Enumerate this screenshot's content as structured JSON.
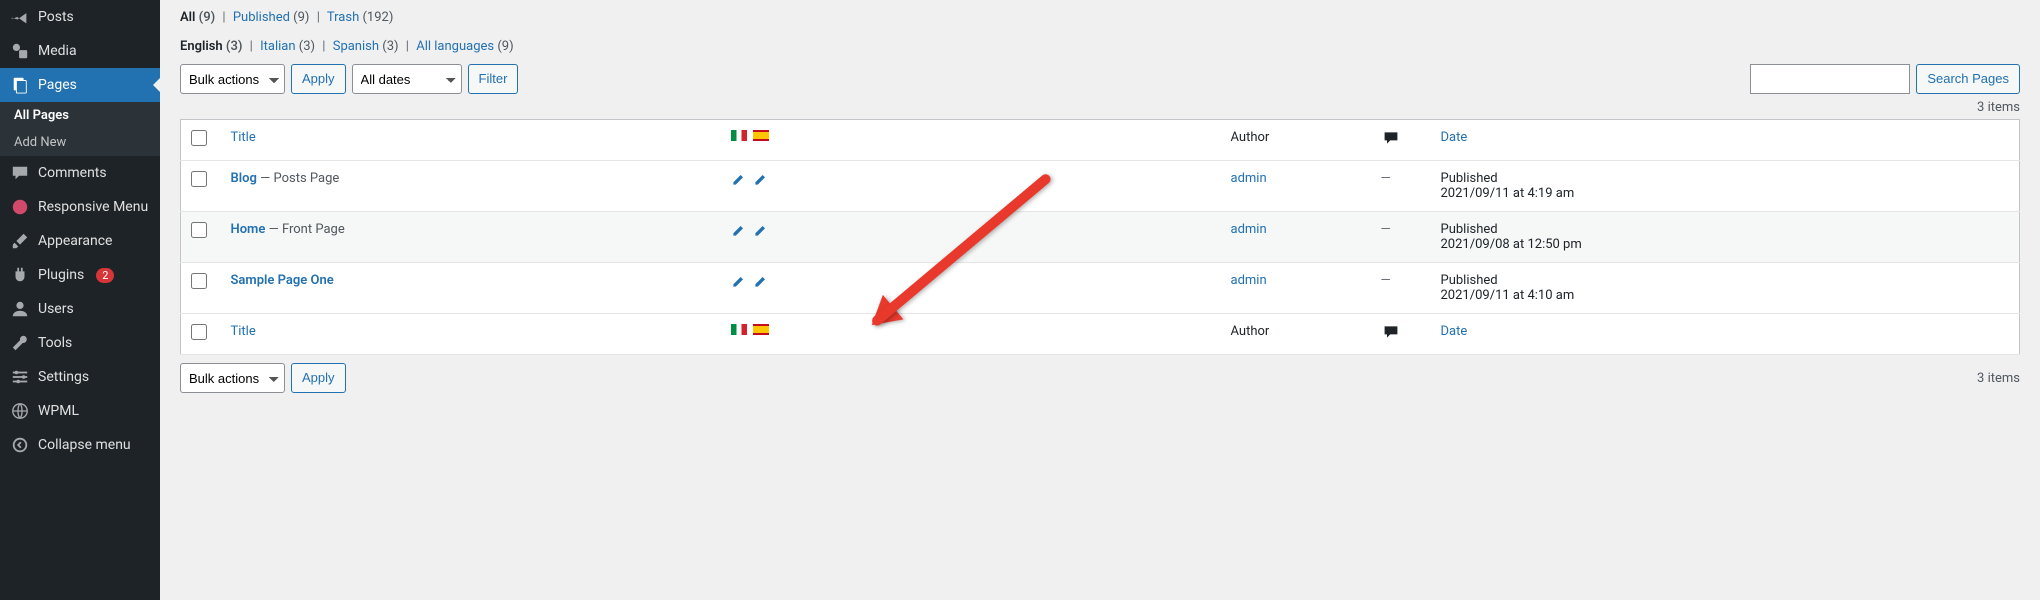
{
  "sidebar": {
    "items": [
      {
        "label": "Posts",
        "icon": "pin"
      },
      {
        "label": "Media",
        "icon": "media"
      },
      {
        "label": "Pages",
        "icon": "page",
        "active": true,
        "submenu": [
          {
            "label": "All Pages",
            "current": true
          },
          {
            "label": "Add New"
          }
        ]
      },
      {
        "label": "Comments",
        "icon": "comment"
      },
      {
        "label": "Responsive Menu",
        "icon": "responsive"
      },
      {
        "label": "Appearance",
        "icon": "brush"
      },
      {
        "label": "Plugins",
        "icon": "plug",
        "badge": "2"
      },
      {
        "label": "Users",
        "icon": "user"
      },
      {
        "label": "Tools",
        "icon": "wrench"
      },
      {
        "label": "Settings",
        "icon": "sliders"
      },
      {
        "label": "WPML",
        "icon": "globe"
      },
      {
        "label": "Collapse menu",
        "icon": "collapse"
      }
    ]
  },
  "filters": {
    "status": [
      {
        "label": "All",
        "count": "(9)",
        "current": true
      },
      {
        "label": "Published",
        "count": "(9)"
      },
      {
        "label": "Trash",
        "count": "(192)"
      }
    ],
    "languages": [
      {
        "label": "English",
        "count": "(3)",
        "current": true
      },
      {
        "label": "Italian",
        "count": "(3)"
      },
      {
        "label": "Spanish",
        "count": "(3)"
      },
      {
        "label": "All languages",
        "count": "(9)"
      }
    ],
    "separator": "|"
  },
  "toolbar": {
    "bulk_label": "Bulk actions",
    "apply_label": "Apply",
    "dates_label": "All dates",
    "filter_label": "Filter",
    "search_placeholder": "",
    "search_button": "Search Pages",
    "items_count": "3 items"
  },
  "table": {
    "columns": {
      "title": "Title",
      "author": "Author",
      "date": "Date"
    },
    "rows": [
      {
        "title": "Blog",
        "state": " — Posts Page",
        "author": "admin",
        "comments": "—",
        "date_label": "Published",
        "date_value": "2021/09/11 at 4:19 am"
      },
      {
        "title": "Home",
        "state": " — Front Page",
        "author": "admin",
        "comments": "—",
        "date_label": "Published",
        "date_value": "2021/09/08 at 12:50 pm"
      },
      {
        "title": "Sample Page One",
        "state": "",
        "author": "admin",
        "comments": "—",
        "date_label": "Published",
        "date_value": "2021/09/11 at 4:10 am"
      }
    ]
  }
}
